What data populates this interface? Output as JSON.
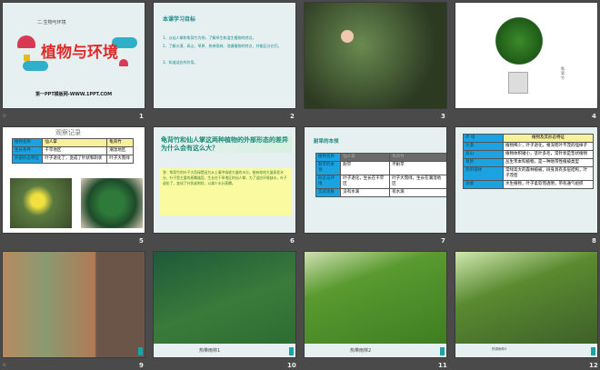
{
  "slides": [
    {
      "number": "1",
      "subtitle": "二.生物与环境",
      "title": "植物与环境",
      "footer": "第一PPT模板网-WWW.1PPT.COM"
    },
    {
      "number": "2",
      "heading": "本课学习目标",
      "items": [
        "1、以仙人掌和龟背竹为例，了解旱生和湿生植物的特点。",
        "2、了解沙漠、高山、草原、热带雨林、池塘植物的特点，并能区分它们。",
        "3、知道适应的作用。"
      ]
    },
    {
      "number": "3"
    },
    {
      "number": "4",
      "caption": "龟背竹"
    },
    {
      "number": "5",
      "title": "观察记录",
      "table": [
        [
          "植物名称",
          "仙人掌",
          "龟背竹"
        ],
        [
          "生长条件",
          "干旱地区",
          "潮湿地区"
        ],
        [
          "外部形态特征",
          "叶子退化了，变成了针状和刺状",
          "叶子大而绿"
        ]
      ]
    },
    {
      "number": "6",
      "question": "龟背竹和仙人掌这两种植物的外部形态的差异为什么会有这么大？",
      "answer": "答：龟背竹的叶子大而绿是因为从土壤中吸收大量的水分，能有效地大量蒸发水分，叶子是主要的蒸腾器官。生长在干旱地区的仙人掌，为了适应环境缺水，叶子退化了，变成了针状或刺状，以减少水分蒸腾。"
    },
    {
      "number": "7",
      "heading": "耐旱的本领",
      "table": [
        [
          "植物名称",
          "仙人掌",
          "龟背竹"
        ],
        [
          "耐旱的本领",
          "耐旱",
          "不耐旱"
        ],
        [
          "形态与环境",
          "叶子退化，生长在干旱区",
          "叶子大而绿，生长在潮湿地区"
        ],
        [
          "实验现象",
          "没有水滴",
          "有水滴"
        ]
      ]
    },
    {
      "number": "8",
      "table": [
        [
          "环 境",
          "植物及其形态特征"
        ],
        [
          "沙漠",
          "植物稀少，叶子退化，根深而叶不茂的怪样子"
        ],
        [
          "高山",
          "植物体积矮小，茎叶多毛，常针状是垫状植物"
        ],
        [
          "草原",
          "丛生禾本科植物，是一种地带性植被类型"
        ],
        [
          "热带雨林",
          "常绿高大的森林植被，树身具有多层结构，叶子茂密"
        ],
        [
          "池塘",
          "水生植物，叶子柔软而透明，带有通气组织"
        ]
      ]
    },
    {
      "number": "9"
    },
    {
      "number": "10",
      "caption": "热带雨林1"
    },
    {
      "number": "11",
      "caption": "热带雨林2"
    },
    {
      "number": "12",
      "caption": "热带雨林3"
    }
  ],
  "anim_marker": "☆"
}
